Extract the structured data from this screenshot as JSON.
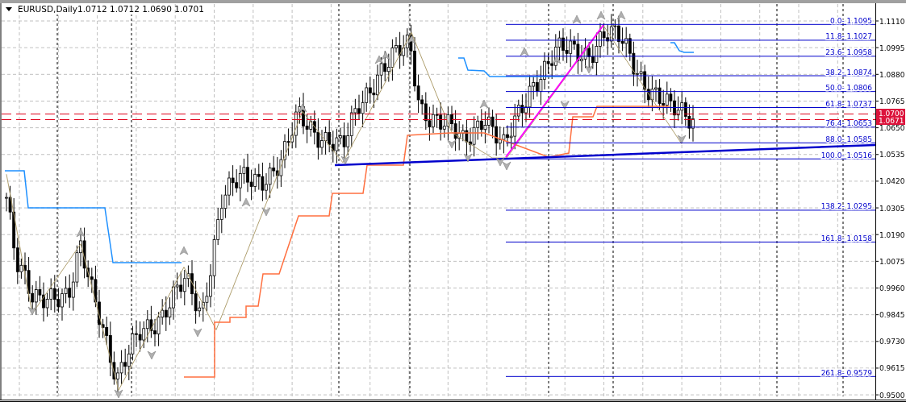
{
  "chart_header": {
    "symbol": "EURUSD,Daily",
    "quotes": "1.0712 1.0712 1.0690 1.0701"
  },
  "fibonacci_levels": [
    {
      "label": "0.0- 1.1095"
    },
    {
      "label": "11.8- 1.1027"
    },
    {
      "label": "23.6- 1.0958"
    },
    {
      "label": "38.2- 1.0874"
    },
    {
      "label": "50.0- 1.0806"
    },
    {
      "label": "61.8- 1.0737"
    },
    {
      "label": "76.4- 1.0653"
    },
    {
      "label": "88.0- 1.0585"
    },
    {
      "label": "100.0- 1.0516"
    },
    {
      "label": "138.2- 1.0295"
    },
    {
      "label": "161.8- 1.0158"
    },
    {
      "label": "261.8- 0.9579"
    }
  ],
  "price_axis": {
    "ticks": [
      "1.1110",
      "1.0995",
      "1.0880",
      "1.0765",
      "1.0650",
      "1.0535",
      "1.0420",
      "1.0305",
      "1.0190",
      "1.0075",
      "0.9960",
      "0.9845",
      "0.9730",
      "0.9615",
      "0.9500"
    ]
  },
  "price_tags": [
    {
      "label": "1.0700"
    },
    {
      "label": "1.0671"
    }
  ]
}
